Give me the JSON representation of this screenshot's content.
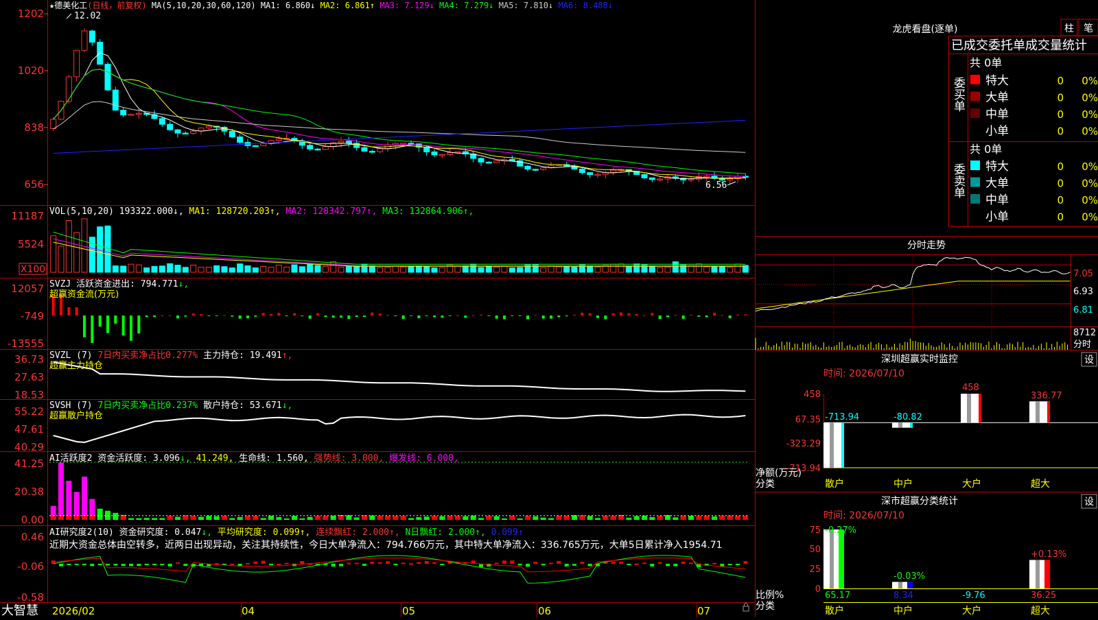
{
  "stock": {
    "name": "德美化工",
    "period_label": "(日线，前复权)",
    "star": "★"
  },
  "bottom": {
    "brand": "大智慧",
    "months": [
      "2026/02",
      "04",
      "05",
      "06",
      "07"
    ]
  },
  "price": {
    "ma_header": "MA(5,10,20,30,60,120)",
    "ma_values": [
      {
        "label": "MA1:",
        "value": "6.860",
        "arrow": "↓",
        "color": "#ffffff"
      },
      {
        "label": "MA2:",
        "value": "6.861",
        "arrow": "↑",
        "color": "#ffff00"
      },
      {
        "label": "MA3:",
        "value": "7.129",
        "arrow": "↓",
        "color": "#ff00ff"
      },
      {
        "label": "MA4:",
        "value": "7.279",
        "arrow": "↓",
        "color": "#00ff00"
      },
      {
        "label": "MA5:",
        "value": "7.810",
        "arrow": "↓",
        "color": "#cccccc"
      },
      {
        "label": "MA6:",
        "value": "8.488",
        "arrow": "↓",
        "color": "#2222ff"
      }
    ],
    "y_labels": [
      "1202",
      "1020",
      "838",
      "656"
    ],
    "high_label": "12.02",
    "low_label": "6.56"
  },
  "vol": {
    "header": "VOL(5,10,20)",
    "value": "193322.000",
    "value_arrow": "↓",
    "ma": [
      {
        "label": "MA1:",
        "value": "128720.203",
        "arrow": "↑",
        "color": "#ffff00"
      },
      {
        "label": "MA2:",
        "value": "128342.797",
        "arrow": "↑",
        "color": "#ff00ff"
      },
      {
        "label": "MA3:",
        "value": "132864.906",
        "arrow": "↑",
        "color": "#00ff00"
      }
    ],
    "y_labels": [
      "11187",
      "5524"
    ],
    "unit": "X100"
  },
  "svzj": {
    "name": "SVZJ",
    "label": "活跃资金进出:",
    "value": "794.771",
    "arrow": "↓",
    "subtitle": "超赢资金流(万元)",
    "y_labels": [
      "12057",
      "-749",
      "-13555"
    ]
  },
  "svzl": {
    "name": "SVZL (7)",
    "desc": "7日内买卖净占比0.277%",
    "label": "主力持仓:",
    "value": "19.491",
    "arrow": "↑",
    "subtitle": "超赢主力持仓",
    "y_labels": [
      "36.73",
      "27.63",
      "18.53"
    ]
  },
  "svsh": {
    "name": "SVSH (7)",
    "desc": "7日内买卖净占比0.237%",
    "label": "散户持仓:",
    "value": "53.671",
    "arrow": "↓",
    "subtitle": "超赢散户持仓",
    "y_labels": [
      "55.22",
      "47.61",
      "40.29"
    ]
  },
  "ai1": {
    "name": "AI活跃度2",
    "label": "资金活跃度:",
    "value": "3.096",
    "arrow": "↓",
    "extra": "41.249",
    "extra_arrow": ",",
    "life_label": "生命线:",
    "life_value": "1.560,",
    "strong_label": "强势线:",
    "strong_value": "3.000,",
    "burst_label": "爆发线:",
    "burst_value": "6.000,",
    "y_labels": [
      "41.25",
      "20.38",
      "0.00"
    ]
  },
  "ai2": {
    "name": "AI研究度2(10)",
    "label": "资金研究度:",
    "value": "0.047",
    "arrow": "↓",
    "avg_label": "平均研究度:",
    "avg_value": "0.099",
    "avg_arrow": "↑",
    "red_label": "连续飘红:",
    "red_value": "2.000",
    "red_arrow": "↑",
    "n_label": "N日飘红:",
    "n_value": "2.000",
    "n_arrow": "↑",
    "last_value": "0.099",
    "last_arrow": "↑",
    "comment": "近期大资金总体由空转多，近两日出现异动，关注其持续性，今日大单净流入：794.766万元，其中特大单净流入：336.765万元，大单5日累计净入1954.71",
    "y_labels": [
      "0.46",
      "-0.06",
      "-0.58"
    ]
  },
  "lhkp": {
    "title": "龙虎看盘(逐单)",
    "tab1": "柱",
    "tab2": "笔",
    "subtitle": "已成交委托单成交量统计",
    "buy_label": "委买单",
    "sell_label": "委卖单",
    "buy_total": "共 0单",
    "sell_total": "共 0单",
    "buy_rows": [
      {
        "name": "特大",
        "val": "0",
        "pct": "0%",
        "color": "#ff0000"
      },
      {
        "name": "大单",
        "val": "0",
        "pct": "0%",
        "color": "#990000"
      },
      {
        "name": "中单",
        "val": "0",
        "pct": "0%",
        "color": "#660000"
      },
      {
        "name": "小单",
        "val": "0",
        "pct": "0%",
        "color": "#000000"
      }
    ],
    "sell_rows": [
      {
        "name": "特大",
        "val": "0",
        "pct": "0%",
        "color": "#00ffff"
      },
      {
        "name": "大单",
        "val": "0",
        "pct": "0%",
        "color": "#009999"
      },
      {
        "name": "中单",
        "val": "0",
        "pct": "0%",
        "color": "#007777"
      },
      {
        "name": "小单",
        "val": "0",
        "pct": "0%",
        "color": "#000000"
      }
    ]
  },
  "intraday": {
    "title": "分时走势",
    "y_labels": [
      "7.05",
      "6.93",
      "6.81"
    ],
    "vol_label": "8712",
    "vol_unit": "分时"
  },
  "sz_monitor": {
    "title": "深圳超赢实时监控",
    "settings": "设",
    "date": "时间: 2026/07/10",
    "y_labels": [
      "458",
      "67.35",
      "-323.29",
      "-713.94"
    ],
    "bar_values": [
      "-713.94",
      "-80.82",
      "458",
      "336.77"
    ],
    "legend1": "净额(万元)",
    "legend2": "分类",
    "categories": [
      "散户",
      "中户",
      "大户",
      "超大"
    ]
  },
  "sz_stats": {
    "title": "深市超赢分类统计",
    "settings": "设",
    "date": "时间: 2026/07/10",
    "y_labels": [
      "75",
      "50",
      "25",
      "0"
    ],
    "top_labels": [
      "-0.27%",
      "-0.03%",
      "",
      "+0.13%"
    ],
    "bottom_values": [
      "65.17",
      "8.34",
      "-9.76",
      "36.25"
    ],
    "legend1": "比例%",
    "legend2": "分类",
    "categories": [
      "散户",
      "中户",
      "大户",
      "超大"
    ]
  }
}
